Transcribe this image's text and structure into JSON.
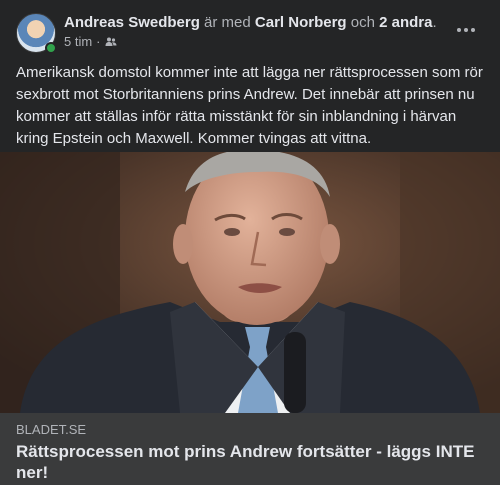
{
  "post": {
    "author": "Andreas Swedberg",
    "with_text": "är med",
    "tagged": "Carl Norberg",
    "and_text": "och",
    "others": "2 andra",
    "period": ".",
    "time": "5 tim",
    "dot": "·",
    "audience_icon": "friends-icon",
    "text": "Amerikansk domstol kommer inte att lägga ner rättsprocessen som rör sexbrott mot Storbritanniens prins Andrew. Det innebär att prinsen nu kommer att ställas inför rätta misstänkt för sin inblandning i härvan kring Epstein och Maxwell. Kommer tvingas att vittna."
  },
  "link_preview": {
    "domain": "BLADET.SE",
    "title": "Rättsprocessen mot prins Andrew fortsätter - läggs INTE ner!"
  },
  "colors": {
    "background": "#242526",
    "preview_bg": "#3a3b3c",
    "online": "#31a24c"
  }
}
